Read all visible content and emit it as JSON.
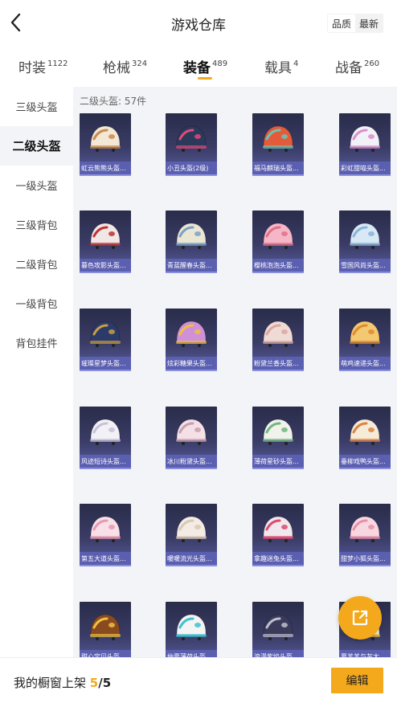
{
  "header": {
    "title": "游戏仓库",
    "back_icon": "chevron-left-icon",
    "sort_options": [
      "品质",
      "最新"
    ],
    "sort_active": "品质"
  },
  "tabs": [
    {
      "label": "时装",
      "count": "1122"
    },
    {
      "label": "枪械",
      "count": "324"
    },
    {
      "label": "装备",
      "count": "489",
      "active": true
    },
    {
      "label": "载具",
      "count": "4"
    },
    {
      "label": "战备",
      "count": "260"
    }
  ],
  "sidebar": [
    {
      "label": "三级头盔"
    },
    {
      "label": "二级头盔",
      "active": true
    },
    {
      "label": "一级头盔"
    },
    {
      "label": "三级背包"
    },
    {
      "label": "二级背包"
    },
    {
      "label": "一级背包"
    },
    {
      "label": "背包挂件"
    }
  ],
  "main": {
    "count_label": "二级头盔: 57件",
    "items": [
      {
        "name": "虹云熊熊头盔...",
        "color": "#f3e7d6",
        "accent": "#c98b4a"
      },
      {
        "name": "小丑头盔(2级)",
        "color": "#2b3a5a",
        "accent": "#e24a7a"
      },
      {
        "name": "福马麒瑞头盔...",
        "color": "#e35b3a",
        "accent": "#6ac6b6"
      },
      {
        "name": "彩虹甜喵头盔...",
        "color": "#f2f2f6",
        "accent": "#d98fd0"
      },
      {
        "name": "暮色攻影头盔...",
        "color": "#f0e8e6",
        "accent": "#c23030"
      },
      {
        "name": "青蓝醒春头盔...",
        "color": "#eae6d2",
        "accent": "#7aa0c8"
      },
      {
        "name": "樱桃泡泡头盔...",
        "color": "#f5b7c8",
        "accent": "#e0708a"
      },
      {
        "name": "雪国风尚头盔...",
        "color": "#d8e8f4",
        "accent": "#8ab4d8"
      },
      {
        "name": "璀璨星梦头盔...",
        "color": "#2c3a6a",
        "accent": "#c8a040"
      },
      {
        "name": "炫彩糖果头盔...",
        "color": "#d090d8",
        "accent": "#f0c040"
      },
      {
        "name": "粉黛兰香头盔...",
        "color": "#f0dad6",
        "accent": "#d8a8a0"
      },
      {
        "name": "萌鸡速递头盔...",
        "color": "#f2c870",
        "accent": "#e08a30"
      },
      {
        "name": "风迹短诗头盔...",
        "color": "#f2f2f6",
        "accent": "#c8c0d8"
      },
      {
        "name": "冰川粉黛头盔...",
        "color": "#f4e0e6",
        "accent": "#c8a0b0"
      },
      {
        "name": "薄荷星砂头盔...",
        "color": "#f2f2ec",
        "accent": "#70b880"
      },
      {
        "name": "垂柳戏鸭头盔...",
        "color": "#f4ecd8",
        "accent": "#e08040"
      },
      {
        "name": "第五大道头盔...",
        "color": "#f8e0e8",
        "accent": "#e898b0"
      },
      {
        "name": "暖暖流光头盔...",
        "color": "#f4ece4",
        "accent": "#d8c8b8"
      },
      {
        "name": "拿趣迷兔头盔...",
        "color": "#f0e8ec",
        "accent": "#e04870"
      },
      {
        "name": "甜梦小狐头盔...",
        "color": "#f8d8e0",
        "accent": "#e890a8"
      },
      {
        "name": "甜心宝贝头盔...",
        "color": "#8a4a20",
        "accent": "#f0c040"
      },
      {
        "name": "仲夏薄荷头盔...",
        "color": "#f4f4f4",
        "accent": "#40c0d0"
      },
      {
        "name": "浪漫紫焰头盔...",
        "color": "#3a3a5a",
        "accent": "#c0c0d0"
      },
      {
        "name": "夏羊羊与灰太...",
        "color": "#f4f0e4",
        "accent": "#f0c040"
      }
    ]
  },
  "share_icon": "share-icon",
  "footer": {
    "label": "我的橱窗上架",
    "current": "5",
    "total": "/5",
    "edit_label": "编辑"
  },
  "colors": {
    "accent": "#f4a81c",
    "card_bg": "#2a2c4a",
    "card_bar": "#5b5fb0",
    "main_bg": "#f2f4f7"
  }
}
